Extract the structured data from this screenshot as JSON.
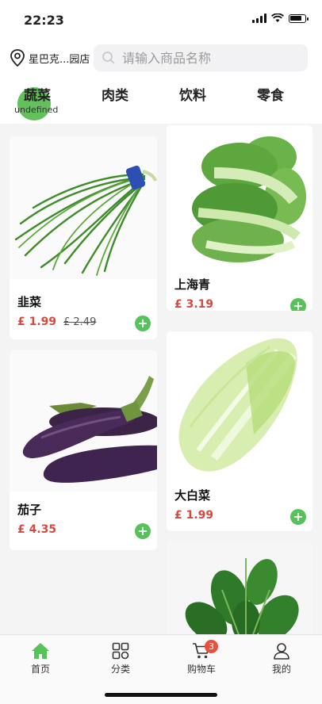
{
  "status": {
    "time": "22:23"
  },
  "header": {
    "store_name": "星巴克...园店",
    "search_placeholder": "请输入商品名称"
  },
  "category_tabs": {
    "items": [
      {
        "label": "蔬菜",
        "active": true
      },
      {
        "label": "肉类",
        "active": false
      },
      {
        "label": "饮料",
        "active": false
      },
      {
        "label": "零食",
        "active": false
      }
    ],
    "active_sub": "undefined"
  },
  "products": [
    {
      "name": "韭菜",
      "price": "£ 1.99",
      "old_price": "£ 2.49"
    },
    {
      "name": "上海青",
      "price": "£ 3.19"
    },
    {
      "name": "茄子",
      "price": "£ 4.35"
    },
    {
      "name": "大白菜",
      "price": "£ 1.99"
    }
  ],
  "tabbar": {
    "items": [
      {
        "label": "首页",
        "icon": "home-icon",
        "active": true
      },
      {
        "label": "分类",
        "icon": "category-icon",
        "active": false
      },
      {
        "label": "购物车",
        "icon": "cart-icon",
        "active": false,
        "badge": "3"
      },
      {
        "label": "我的",
        "icon": "user-icon",
        "active": false
      }
    ]
  },
  "colors": {
    "accent": "#56c35a",
    "price": "#d5493f",
    "badge": "#e94f3d"
  }
}
